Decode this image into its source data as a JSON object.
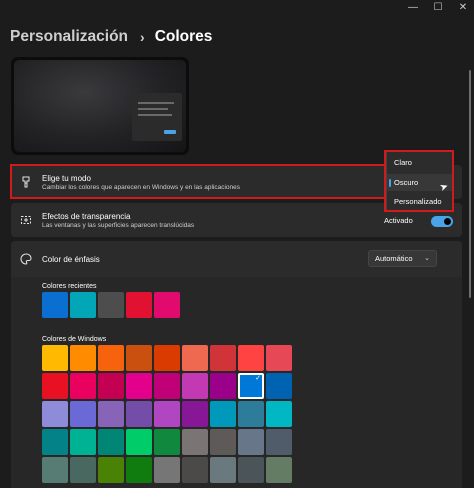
{
  "window": {
    "minimize_glyph": "—",
    "maximize_glyph": "☐",
    "close_glyph": "✕"
  },
  "breadcrumb": {
    "parent": "Personalización",
    "separator": "›",
    "current": "Colores"
  },
  "mode_card": {
    "icon": "brush-icon",
    "title": "Elige tu modo",
    "subtitle": "Cambiar los colores que aparecen en Windows y en las aplicaciones"
  },
  "mode_menu": {
    "options": [
      "Claro",
      "Oscuro",
      "Personalizado"
    ],
    "selected": "Oscuro"
  },
  "transparency_card": {
    "icon": "transparency-icon",
    "title": "Efectos de transparencia",
    "subtitle": "Las ventanas y las superficies aparecen translúcidas",
    "state_label": "Activado",
    "on": true
  },
  "accent_card": {
    "icon": "palette-icon",
    "title": "Color de énfasis",
    "select_value": "Automático",
    "recent_label": "Colores recientes",
    "windows_label": "Colores de Windows"
  },
  "recent_colors": [
    "#0a6fd1",
    "#02a6b6",
    "#4d4d4d",
    "#e11231",
    "#e10b6e"
  ],
  "windows_colors": [
    [
      "#ffb900",
      "#ff8c00",
      "#f7630c",
      "#ca5010",
      "#da3b01",
      "#ef6950",
      "#d13438",
      "#ff4343",
      "#e74856"
    ],
    [
      "#e81123",
      "#ea005e",
      "#c30052",
      "#e3008c",
      "#bf0077",
      "#c239b3",
      "#9a0089",
      "#0078d7",
      "#0063b1"
    ],
    [
      "#8e8cd8",
      "#6b69d6",
      "#8764b8",
      "#744da9",
      "#b146c2",
      "#881798",
      "#0099bc",
      "#2d7d9a",
      "#00b7c3"
    ],
    [
      "#038387",
      "#00b294",
      "#018574",
      "#00cc6a",
      "#10893e",
      "#7a7574",
      "#5d5a58",
      "#68768a",
      "#515c6b"
    ],
    [
      "#567c73",
      "#486860",
      "#498205",
      "#107c10",
      "#767676",
      "#4c4a48",
      "#69797e",
      "#4a5459",
      "#647c64"
    ]
  ],
  "selected_color": "#0078d7",
  "selected_check": "✓"
}
